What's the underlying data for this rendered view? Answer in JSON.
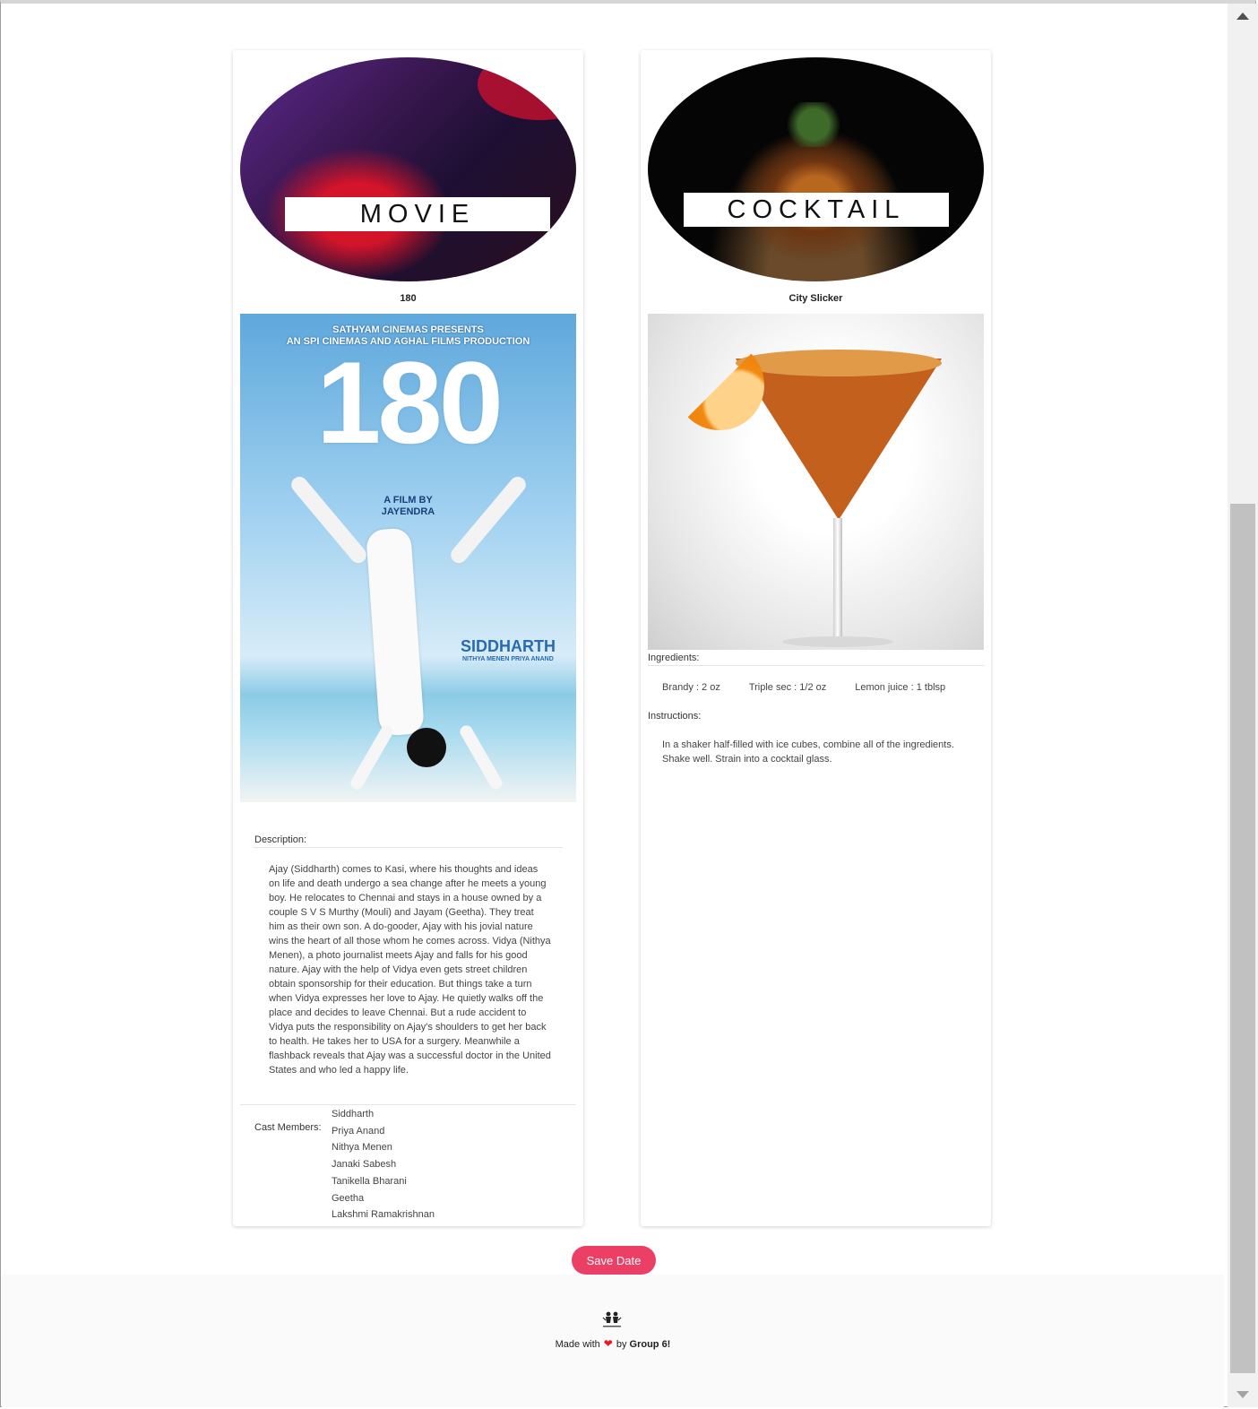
{
  "movie": {
    "oval_label": "MOVIE",
    "title": "180",
    "poster": {
      "header_line1": "SATHYAM CINEMAS PRESENTS",
      "header_line2": "AN SPI CINEMAS AND AGHAL FILMS PRODUCTION",
      "number": "180",
      "director_line1": "A FILM BY",
      "director_line2": "JAYENDRA",
      "actor": "SIDDHARTH",
      "costars": "NITHYA MENEN   PRIYA ANAND"
    },
    "description_label": "Description:",
    "description": "Ajay (Siddharth) comes to Kasi, where his thoughts and ideas on life and death undergo a sea change after he meets a young boy. He relocates to Chennai and stays in a house owned by a couple S V S Murthy (Mouli) and Jayam (Geetha). They treat him as their own son. A do-gooder, Ajay with his jovial nature wins the heart of all those whom he comes across. Vidya (Nithya Menen), a photo journalist meets Ajay and falls for his good nature. Ajay with the help of Vidya even gets street children obtain sponsorship for their education. But things take a turn when Vidya expresses her love to Ajay. He quietly walks off the place and decides to leave Chennai. But a rude accident to Vidya puts the responsibility on Ajay's shoulders to get her back to health. He takes her to USA for a surgery. Meanwhile a flashback reveals that Ajay was a successful doctor in the United States and who led a happy life.",
    "cast_label": "Cast Members:",
    "cast": [
      "Siddharth",
      "Priya Anand",
      "Nithya Menen",
      "Janaki Sabesh",
      "Tanikella Bharani",
      "Geetha",
      "Lakshmi Ramakrishnan"
    ]
  },
  "cocktail": {
    "oval_label": "COCKTAIL",
    "title": "City Slicker",
    "ingredients_label": "Ingredients:",
    "ingredients": [
      "Brandy : 2 oz",
      "Triple sec : 1/2 oz",
      "Lemon juice : 1 tblsp"
    ],
    "instructions_label": "Instructions:",
    "instructions": "In a shaker half-filled with ice cubes, combine all of the ingredients. Shake well. Strain into a cocktail glass."
  },
  "actions": {
    "save_label": "Save Date"
  },
  "footer": {
    "made_with": "Made with",
    "by": "by",
    "group": "Group 6!"
  },
  "colors": {
    "accent": "#ec3f66",
    "heart": "#e61b23",
    "footer_bg": "#fafafa"
  },
  "icons": {
    "scroll_up": "triangle-up-icon",
    "scroll_down": "triangle-down-icon",
    "heart": "heart-icon",
    "logo": "group-logo-icon"
  }
}
